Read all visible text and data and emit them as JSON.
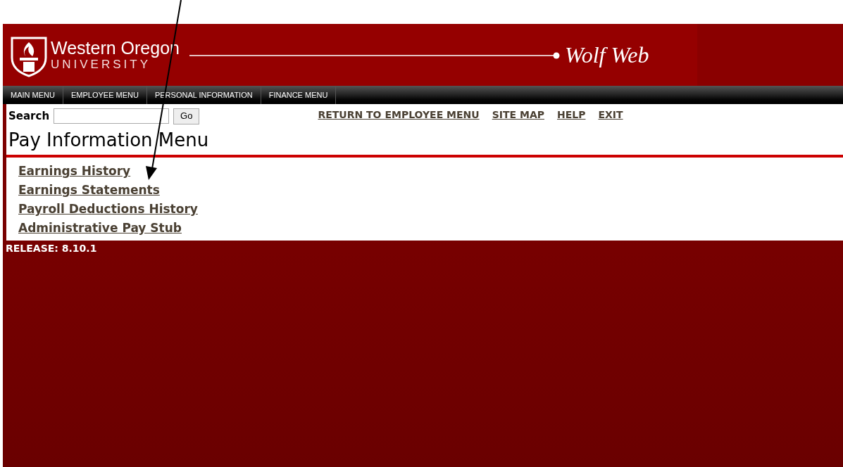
{
  "header": {
    "logo_line1": "Western Oregon",
    "logo_line2": "UNIVERSITY",
    "site_name": "Wolf Web"
  },
  "nav": [
    {
      "label": "MAIN MENU"
    },
    {
      "label": "EMPLOYEE MENU"
    },
    {
      "label": "PERSONAL INFORMATION"
    },
    {
      "label": "FINANCE MENU"
    }
  ],
  "search": {
    "label": "Search",
    "button": "Go"
  },
  "top_links": [
    "RETURN TO EMPLOYEE MENU",
    "SITE MAP",
    "HELP",
    "EXIT"
  ],
  "page_title": "Pay Information Menu",
  "menu_links": [
    "Earnings History",
    "Earnings Statements",
    "Payroll Deductions History",
    "Administrative Pay Stub"
  ],
  "release": "RELEASE: 8.10.1"
}
